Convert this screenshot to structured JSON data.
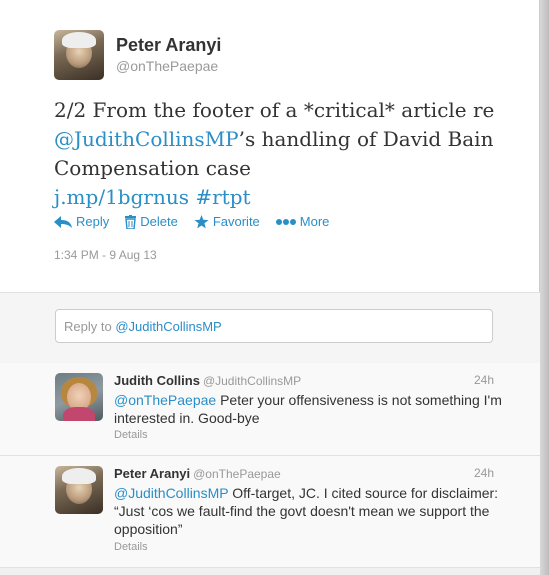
{
  "main_tweet": {
    "author_name": "Peter Aranyi",
    "author_handle": "@onThePaepae",
    "text_1": "2/2 From the footer of a *critical* article re",
    "mention": "@JudithCollinsMP",
    "text_2": "’s handling of David Bain Compensation case",
    "short_link": "j.mp/1bgrnus",
    "hashtag": "#rtpt",
    "actions": {
      "reply": "Reply",
      "delete": "Delete",
      "favorite": "Favorite",
      "more": "More"
    },
    "timestamp": "1:34 PM - 9 Aug 13"
  },
  "reply_box": {
    "prefix": "Reply to",
    "mention": "@JudithCollinsMP"
  },
  "replies": [
    {
      "name": "Judith Collins",
      "handle": "@JudithCollinsMP",
      "time": "24h",
      "mention": "@onThePaepae",
      "text": " Peter your offensiveness is not something I'm interested in. Good-bye",
      "details": "Details"
    },
    {
      "name": "Peter Aranyi",
      "handle": "@onThePaepae",
      "time": "24h",
      "mention": "@JudithCollinsMP",
      "text": " Off-target, JC. I cited source for disclaimer: “Just ‘cos we fault-find the govt doesn't mean we support the opposition”",
      "details": "Details"
    }
  ],
  "colors": {
    "link": "#2a8ec7",
    "muted": "#999999",
    "text": "#333333"
  }
}
